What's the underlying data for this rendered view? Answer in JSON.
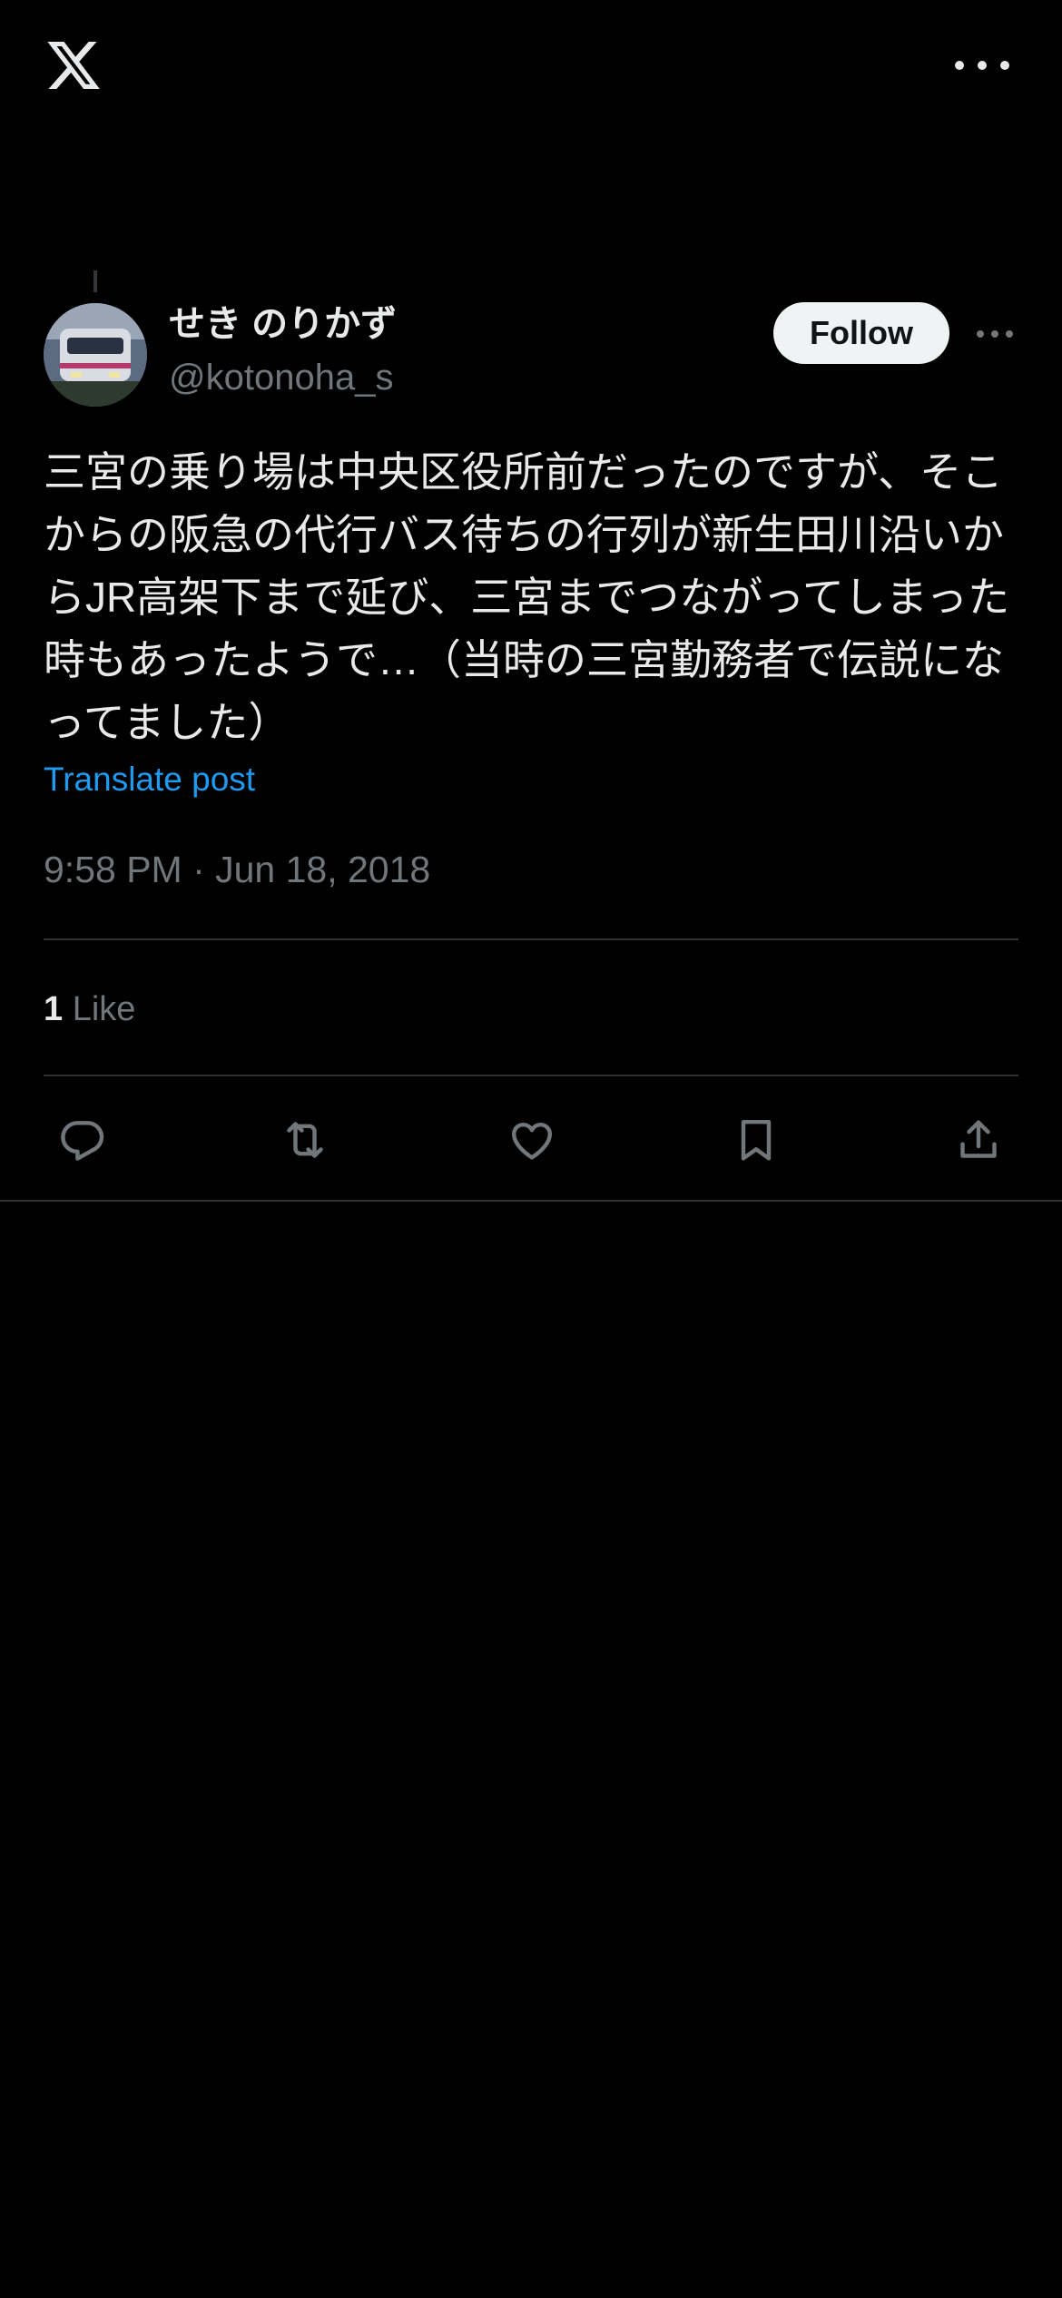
{
  "post": {
    "author": {
      "display_name": "せき のりかず",
      "handle": "@kotonoha_s"
    },
    "follow_label": "Follow",
    "text": "三宮の乗り場は中央区役所前だったのですが、そこからの阪急の代行バス待ちの行列が新生田川沿いからJR高架下まで延び、三宮までつながってしまった時もあったようで…（当時の三宮勤務者で伝説になってました）",
    "translate_label": "Translate post",
    "timestamp": "9:58 PM · Jun 18, 2018",
    "likes": {
      "count": "1",
      "label": "Like"
    }
  },
  "icons": {
    "logo": "x-logo-icon",
    "more": "more-horizontal-icon",
    "reply": "reply-icon",
    "repost": "repost-icon",
    "like": "heart-icon",
    "bookmark": "bookmark-icon",
    "share": "share-icon"
  },
  "colors": {
    "background": "#000000",
    "text": "#e7e9ea",
    "secondary": "#71767b",
    "link": "#1d9bf0",
    "divider": "#2f3336"
  }
}
